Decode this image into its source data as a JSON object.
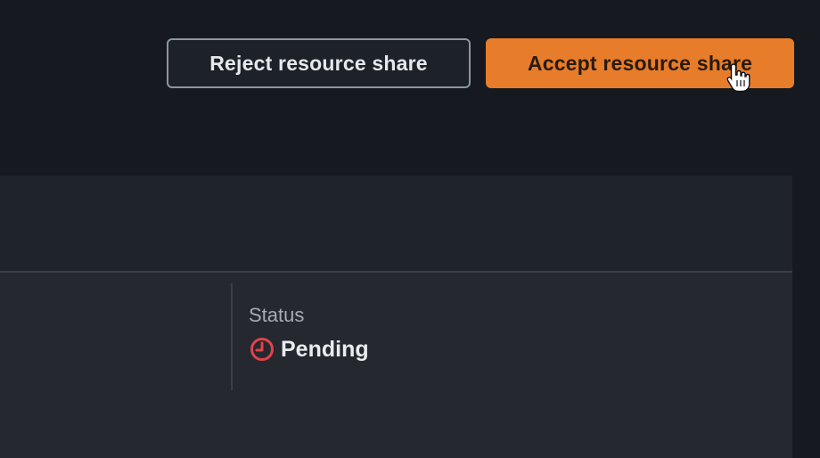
{
  "header": {
    "actions": {
      "reject_label": "Reject resource share",
      "accept_label": "Accept resource share"
    }
  },
  "details": {
    "status": {
      "label": "Status",
      "value": "Pending",
      "icon": "pending-clock-icon",
      "color": "#d13212"
    }
  },
  "theme": {
    "accent": "#e77d2a",
    "background": "#16191f",
    "panel": "#25282e"
  }
}
